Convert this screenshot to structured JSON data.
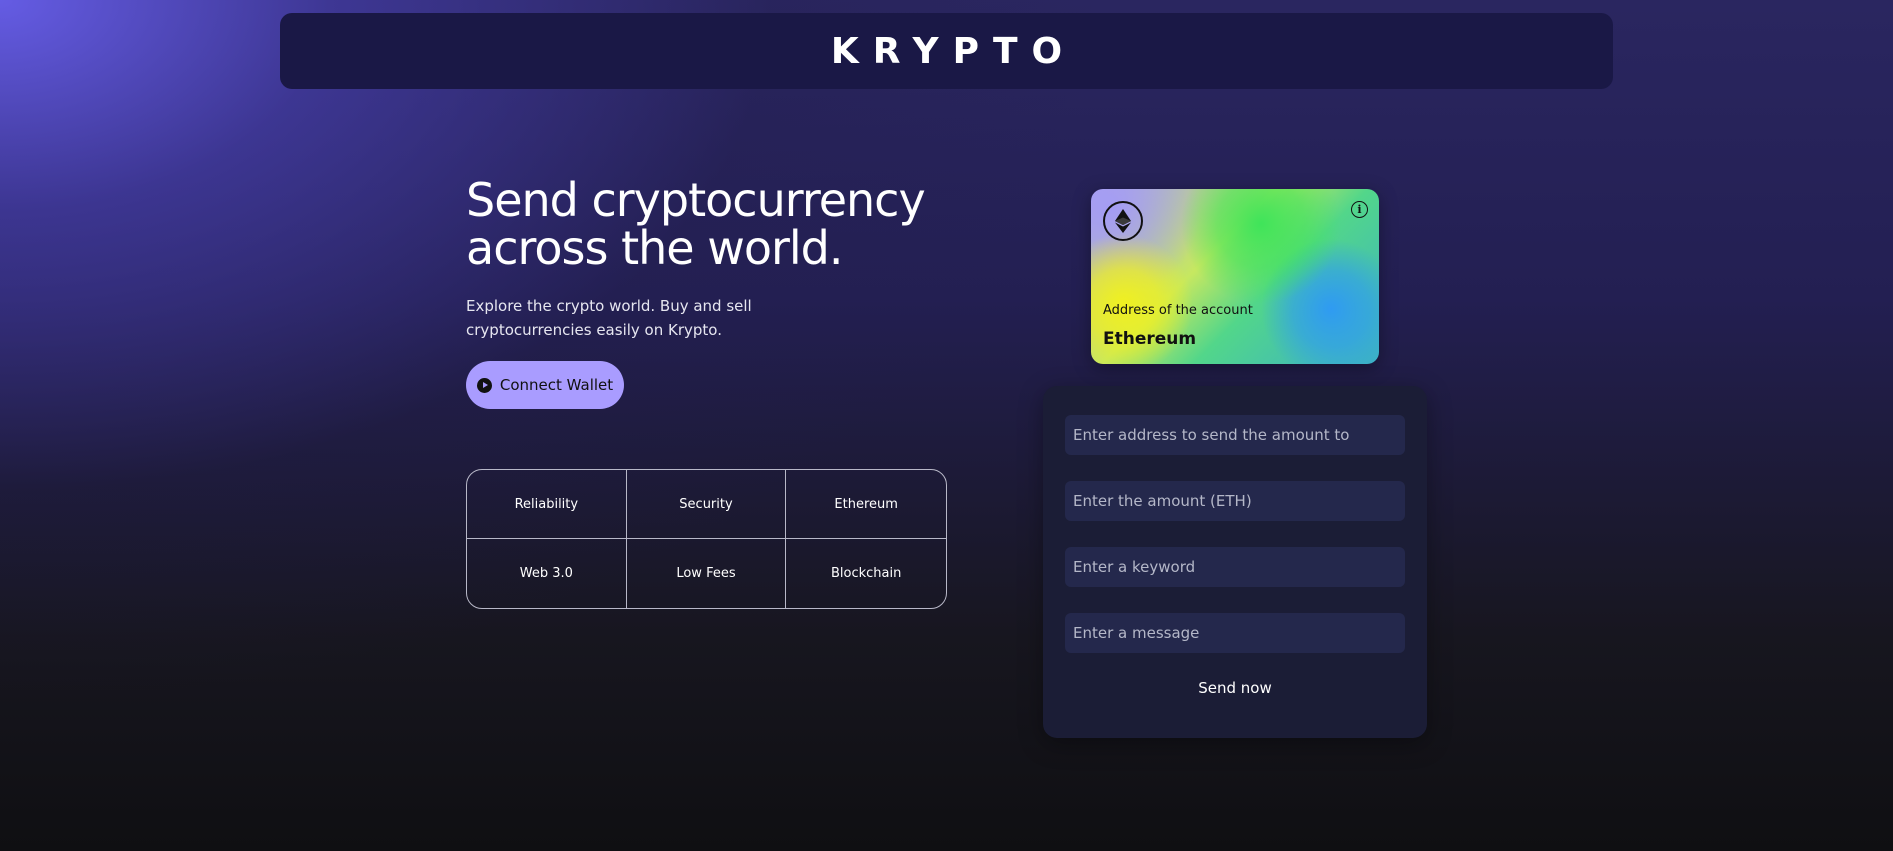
{
  "nav": {
    "logo": "KRYPTO"
  },
  "hero": {
    "title": "Send cryptocurrency across the world.",
    "subtitle": "Explore the crypto world. Buy and sell cryptocurrencies easily on Krypto.",
    "connect_label": "Connect Wallet"
  },
  "features": [
    {
      "label": "Reliability"
    },
    {
      "label": "Security"
    },
    {
      "label": "Ethereum"
    },
    {
      "label": "Web 3.0"
    },
    {
      "label": "Low Fees"
    },
    {
      "label": "Blockchain"
    }
  ],
  "card": {
    "address_label": "Address of the account",
    "network": "Ethereum",
    "logo_icon": "ethereum-icon",
    "info_icon": "info-icon"
  },
  "form": {
    "address_placeholder": "Enter address to send the amount to",
    "amount_placeholder": "Enter the amount (ETH)",
    "keyword_placeholder": "Enter a keyword",
    "message_placeholder": "Enter a message",
    "send_label": "Send now"
  },
  "colors": {
    "accent": "#a99cff",
    "nav_bg": "#1a1846",
    "panel_bg": "#1b1d36",
    "field_bg": "#24284c"
  }
}
